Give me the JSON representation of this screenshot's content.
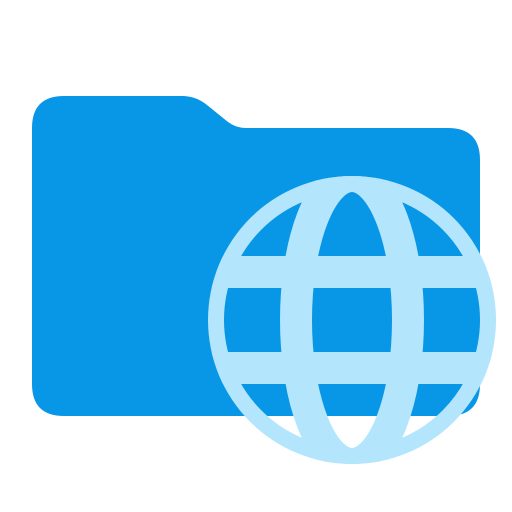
{
  "icon": {
    "name": "folder-web-icon",
    "parts": [
      "folder-icon",
      "globe-icon"
    ]
  },
  "colors": {
    "folder": "#0797E6",
    "globe": "#B3E5FC"
  }
}
